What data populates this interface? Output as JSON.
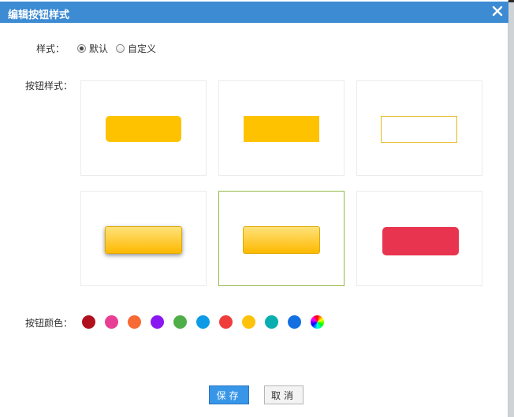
{
  "dialog": {
    "title": "编辑按钮样式",
    "close_icon": "close-icon"
  },
  "style_mode": {
    "label": "样式：",
    "options": [
      {
        "label": "默认",
        "checked": true
      },
      {
        "label": "自定义",
        "checked": false
      }
    ]
  },
  "button_style": {
    "label": "按钮样式：",
    "options": [
      {
        "name": "rounded-flat",
        "color": "#fec200"
      },
      {
        "name": "square-flat",
        "color": "#fec200"
      },
      {
        "name": "outline",
        "color": "#fec200"
      },
      {
        "name": "raised-shadow",
        "color": "#fec200"
      },
      {
        "name": "gradient",
        "color": "#fec200",
        "selected": true
      },
      {
        "name": "rounded-red",
        "color": "#e8344e"
      }
    ]
  },
  "button_color": {
    "label": "按钮颜色：",
    "swatches": [
      "#b0101e",
      "#e83e93",
      "#f86a34",
      "#8b17f0",
      "#4eae47",
      "#0d9be5",
      "#ef3d3d",
      "#fec20a",
      "#0aaeb0",
      "#1470e1",
      "rainbow-picker"
    ]
  },
  "actions": {
    "save_label": "保存",
    "cancel_label": "取消"
  }
}
